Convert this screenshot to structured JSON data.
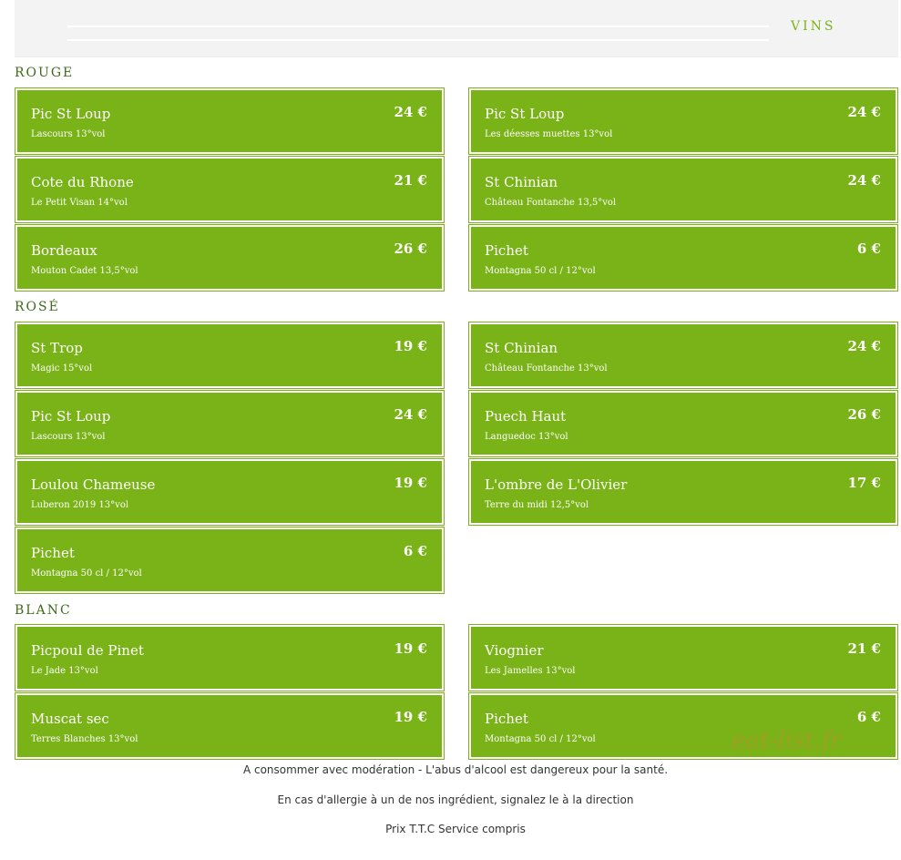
{
  "header": {
    "title": "VINS"
  },
  "sections": [
    {
      "title": "ROUGE",
      "items": [
        {
          "name": "Pic St Loup",
          "desc": "Lascours 13°vol",
          "price": "24 €"
        },
        {
          "name": "Cote du Rhone",
          "desc": "Le Petit Visan 14°vol",
          "price": "21 €"
        },
        {
          "name": "Bordeaux",
          "desc": "Mouton Cadet 13,5°vol",
          "price": "26 €"
        },
        {
          "name": "Pic St Loup",
          "desc": "Les déesses muettes 13°vol",
          "price": "24 €"
        },
        {
          "name": "St Chinian",
          "desc": "Château Fontanche 13,5°vol",
          "price": "24 €"
        },
        {
          "name": "Pichet",
          "desc": "Montagna 50 cl / 12°vol",
          "price": "6 €"
        }
      ]
    },
    {
      "title": "ROSÉ",
      "items": [
        {
          "name": "St Trop",
          "desc": "Magic 15°vol",
          "price": "19 €"
        },
        {
          "name": "Pic St Loup",
          "desc": "Lascours 13°vol",
          "price": "24 €"
        },
        {
          "name": "Loulou Chameuse",
          "desc": "Luberon 2019 13°vol",
          "price": "19 €"
        },
        {
          "name": "Pichet",
          "desc": "Montagna 50 cl / 12°vol",
          "price": "6 €"
        },
        {
          "name": "St Chinian",
          "desc": "Château Fontanche 13°vol",
          "price": "24 €"
        },
        {
          "name": "Puech Haut",
          "desc": "Languedoc 13°vol",
          "price": "26 €"
        },
        {
          "name": "L'ombre de L'Olivier",
          "desc": "Terre du midi 12,5°vol",
          "price": "17 €"
        }
      ]
    },
    {
      "title": "BLANC",
      "items": [
        {
          "name": "Picpoul de Pinet",
          "desc": "Le Jade 13°vol",
          "price": "19 €"
        },
        {
          "name": "Muscat sec",
          "desc": "Terres Blanches 13°vol",
          "price": "19 €"
        },
        {
          "name": "Viognier",
          "desc": "Les Jamelles 13°vol",
          "price": "21 €"
        },
        {
          "name": "Pichet",
          "desc": "Montagna 50 cl / 12°vol",
          "price": "6 €"
        }
      ]
    }
  ],
  "footer": {
    "line1": "A consommer avec modération - L'abus d'alcool est dangereux pour la santé.",
    "line2": "En cas d'allergie à un de nos ingrédient, signalez le à la direction",
    "line3": "Prix T.T.C Service compris"
  },
  "watermark": "eat-list.fr",
  "colors": {
    "accent": "#7ab317",
    "section_title": "#3e6a1a"
  }
}
